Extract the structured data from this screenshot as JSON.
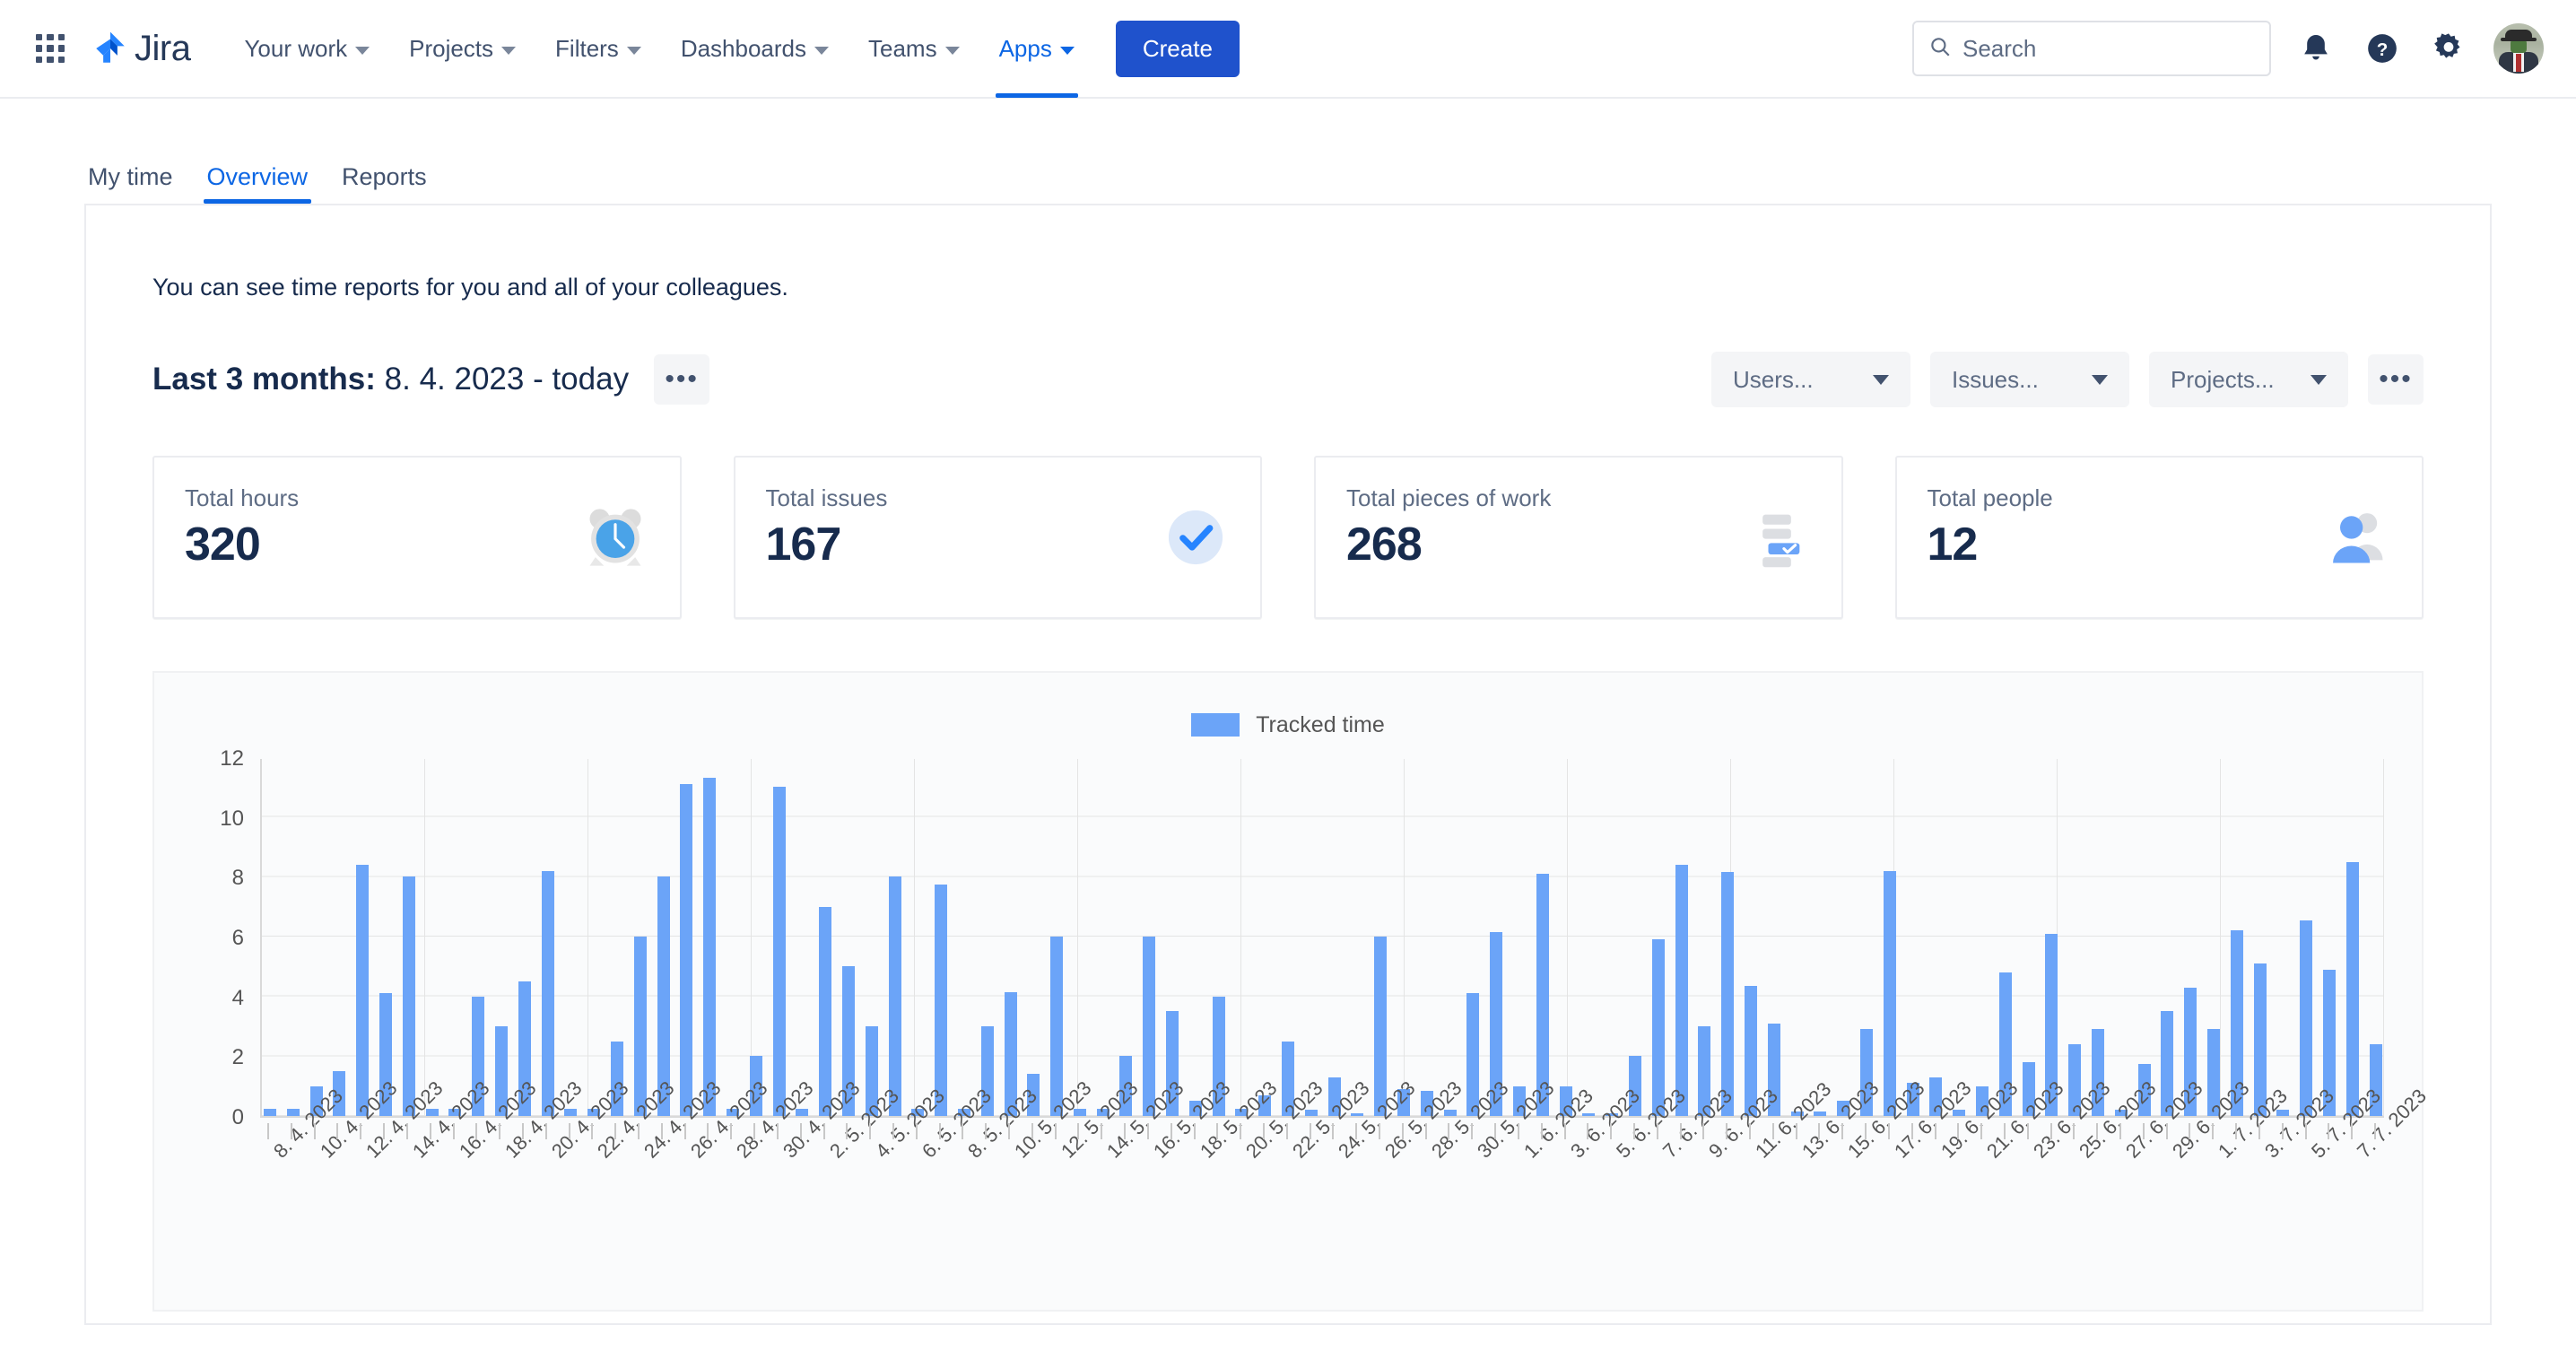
{
  "nav": {
    "app_switcher_icon": "grid-icon",
    "brand": "Jira",
    "items": [
      {
        "label": "Your work",
        "has_caret": true,
        "active": false
      },
      {
        "label": "Projects",
        "has_caret": true,
        "active": false
      },
      {
        "label": "Filters",
        "has_caret": true,
        "active": false
      },
      {
        "label": "Dashboards",
        "has_caret": true,
        "active": false
      },
      {
        "label": "Teams",
        "has_caret": true,
        "active": false
      },
      {
        "label": "Apps",
        "has_caret": true,
        "active": true
      }
    ],
    "create_label": "Create",
    "search_placeholder": "Search",
    "search_value": "",
    "icons": [
      "search-icon",
      "notifications-bell-icon",
      "help-icon",
      "settings-gear-icon",
      "avatar"
    ]
  },
  "tabs": [
    {
      "label": "My time",
      "active": false
    },
    {
      "label": "Overview",
      "active": true
    },
    {
      "label": "Reports",
      "active": false
    }
  ],
  "main": {
    "intro": "You can see time reports for you and all of your colleagues.",
    "range_prefix": "Last 3 months:",
    "range_value": "8. 4. 2023 - today",
    "range_more_label": "•••",
    "filters": [
      {
        "label": "Users...",
        "name": "users-filter"
      },
      {
        "label": "Issues...",
        "name": "issues-filter"
      },
      {
        "label": "Projects...",
        "name": "projects-filter"
      }
    ],
    "filters_more_label": "•••"
  },
  "cards": [
    {
      "label": "Total hours",
      "value": "320",
      "icon": "alarm-clock-icon"
    },
    {
      "label": "Total issues",
      "value": "167",
      "icon": "check-circle-icon"
    },
    {
      "label": "Total pieces of work",
      "value": "268",
      "icon": "stacked-list-icon"
    },
    {
      "label": "Total people",
      "value": "12",
      "icon": "people-icon"
    }
  ],
  "colors": {
    "accent": "#0c66e4",
    "create_button": "#1f52cc",
    "bar": "#6ba4f8",
    "text": "#172b4d",
    "muted": "#5e6c84",
    "panel_border": "#ebecf0",
    "chart_bg": "#fafbfc"
  },
  "chart_data": {
    "type": "bar",
    "title": "",
    "xlabel": "",
    "ylabel": "",
    "legend": [
      {
        "name": "Tracked time",
        "color": "#6ba4f8"
      }
    ],
    "legend_position": "top-center",
    "grid": true,
    "ylim": [
      0,
      12
    ],
    "yticks": [
      0,
      2,
      4,
      6,
      8,
      10,
      12
    ],
    "categories": [
      "8. 4. 2023",
      "9. 4. 2023",
      "10. 4. 2023",
      "11. 4. 2023",
      "12. 4. 2023",
      "13. 4. 2023",
      "14. 4. 2023",
      "15. 4. 2023",
      "16. 4. 2023",
      "17. 4. 2023",
      "18. 4. 2023",
      "19. 4. 2023",
      "20. 4. 2023",
      "21. 4. 2023",
      "22. 4. 2023",
      "23. 4. 2023",
      "24. 4. 2023",
      "25. 4. 2023",
      "26. 4. 2023",
      "27. 4. 2023",
      "28. 4. 2023",
      "29. 4. 2023",
      "30. 4. 2023",
      "1. 5. 2023",
      "2. 5. 2023",
      "3. 5. 2023",
      "4. 5. 2023",
      "5. 5. 2023",
      "6. 5. 2023",
      "7. 5. 2023",
      "8. 5. 2023",
      "9. 5. 2023",
      "10. 5. 2023",
      "11. 5. 2023",
      "12. 5. 2023",
      "13. 5. 2023",
      "14. 5. 2023",
      "15. 5. 2023",
      "16. 5. 2023",
      "17. 5. 2023",
      "18. 5. 2023",
      "19. 5. 2023",
      "20. 5. 2023",
      "21. 5. 2023",
      "22. 5. 2023",
      "23. 5. 2023",
      "24. 5. 2023",
      "25. 5. 2023",
      "26. 5. 2023",
      "27. 5. 2023",
      "28. 5. 2023",
      "29. 5. 2023",
      "30. 5. 2023",
      "31. 5. 2023",
      "1. 6. 2023",
      "2. 6. 2023",
      "3. 6. 2023",
      "4. 6. 2023",
      "5. 6. 2023",
      "6. 6. 2023",
      "7. 6. 2023",
      "8. 6. 2023",
      "9. 6. 2023",
      "10. 6. 2023",
      "11. 6. 2023",
      "12. 6. 2023",
      "13. 6. 2023",
      "14. 6. 2023",
      "15. 6. 2023",
      "16. 6. 2023",
      "17. 6. 2023",
      "18. 6. 2023",
      "19. 6. 2023",
      "20. 6. 2023",
      "21. 6. 2023",
      "22. 6. 2023",
      "23. 6. 2023",
      "24. 6. 2023",
      "25. 6. 2023",
      "26. 6. 2023",
      "27. 6. 2023",
      "28. 6. 2023",
      "29. 6. 2023",
      "30. 6. 2023",
      "1. 7. 2023",
      "2. 7. 2023",
      "3. 7. 2023",
      "4. 7. 2023",
      "5. 7. 2023",
      "6. 7. 2023",
      "7. 7. 2023"
    ],
    "tick_labels": [
      "8. 4. 2023",
      "10. 4. 2023",
      "12. 4. 2023",
      "14. 4. 2023",
      "16. 4. 2023",
      "18. 4. 2023",
      "20. 4. 2023",
      "22. 4. 2023",
      "24. 4. 2023",
      "26. 4. 2023",
      "28. 4. 2023",
      "30. 4. 2023",
      "2. 5. 2023",
      "4. 5. 2023",
      "6. 5. 2023",
      "8. 5. 2023",
      "10. 5. 2023",
      "12. 5. 2023",
      "14. 5. 2023",
      "16. 5. 2023",
      "18. 5. 2023",
      "20. 5. 2023",
      "22. 5. 2023",
      "24. 5. 2023",
      "26. 5. 2023",
      "28. 5. 2023",
      "30. 5. 2023",
      "1. 6. 2023",
      "3. 6. 2023",
      "5. 6. 2023",
      "7. 6. 2023",
      "9. 6. 2023",
      "11. 6. 2023",
      "13. 6. 2023",
      "15. 6. 2023",
      "17. 6. 2023",
      "19. 6. 2023",
      "21. 6. 2023",
      "23. 6. 2023",
      "25. 6. 2023",
      "27. 6. 2023",
      "29. 6. 2023",
      "1. 7. 2023",
      "3. 7. 2023",
      "5. 7. 2023",
      "7. 7. 2023"
    ],
    "series": [
      {
        "name": "Tracked time",
        "color": "#6ba4f8",
        "values": [
          0.25,
          0.25,
          1.0,
          1.5,
          8.4,
          4.1,
          8.0,
          0.25,
          0.25,
          4.0,
          3.0,
          4.5,
          8.2,
          0.25,
          0.25,
          2.5,
          6.0,
          8.0,
          11.1,
          11.3,
          0.25,
          2.0,
          11.0,
          0.25,
          7.0,
          5.0,
          3.0,
          8.0,
          0.25,
          7.75,
          0.25,
          3.0,
          4.15,
          1.4,
          6.0,
          0.25,
          0.25,
          2.0,
          6.0,
          3.5,
          0.5,
          4.0,
          0.25,
          0.7,
          2.5,
          0.2,
          1.3,
          0.1,
          6.0,
          0.9,
          0.85,
          0.2,
          4.1,
          6.15,
          1.0,
          8.1,
          1.0,
          0.1,
          0.1,
          2.0,
          5.9,
          8.4,
          3.0,
          8.15,
          4.35,
          3.1,
          0.15,
          0.15,
          0.5,
          2.9,
          8.2,
          1.1,
          1.3,
          0.2,
          1.0,
          4.8,
          1.8,
          6.1,
          2.4,
          2.9,
          0.2,
          1.75,
          3.5,
          4.3,
          2.9,
          6.2,
          5.1,
          0.2,
          6.55,
          4.9,
          8.5,
          2.4
        ]
      }
    ]
  }
}
